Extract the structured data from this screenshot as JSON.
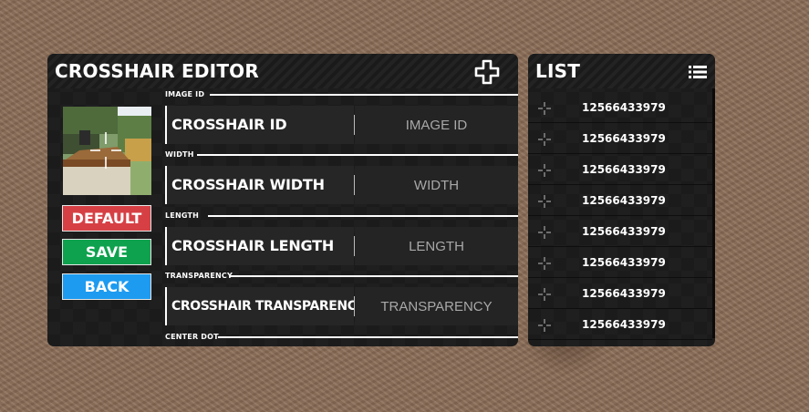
{
  "editor": {
    "title": "CROSSHAIR EDITOR",
    "add_icon": "plus-outline-icon",
    "buttons": {
      "default_label": "DEFAULT",
      "save_label": "SAVE",
      "back_label": "BACK"
    },
    "colors": {
      "default": "#d64045",
      "save": "#0ea24e",
      "back": "#1d9bf0"
    },
    "sections": [
      {
        "label": "IMAGE ID",
        "field_name": "CROSSHAIR ID",
        "placeholder": "IMAGE ID"
      },
      {
        "label": "WIDTH",
        "field_name": "CROSSHAIR WIDTH",
        "placeholder": "WIDTH"
      },
      {
        "label": "LENGTH",
        "field_name": "CROSSHAIR LENGTH",
        "placeholder": "LENGTH"
      },
      {
        "label": "TRANSPARENCY",
        "field_name": "CROSSHAIR TRANSPARENCY",
        "placeholder": "TRANSPARENCY"
      },
      {
        "label": "CENTER DOT"
      }
    ]
  },
  "list": {
    "title": "LIST",
    "menu_icon": "list-icon",
    "item_icon": "crosshair-icon",
    "items": [
      "12566433979",
      "12566433979",
      "12566433979",
      "12566433979",
      "12566433979",
      "12566433979",
      "12566433979",
      "12566433979"
    ]
  }
}
